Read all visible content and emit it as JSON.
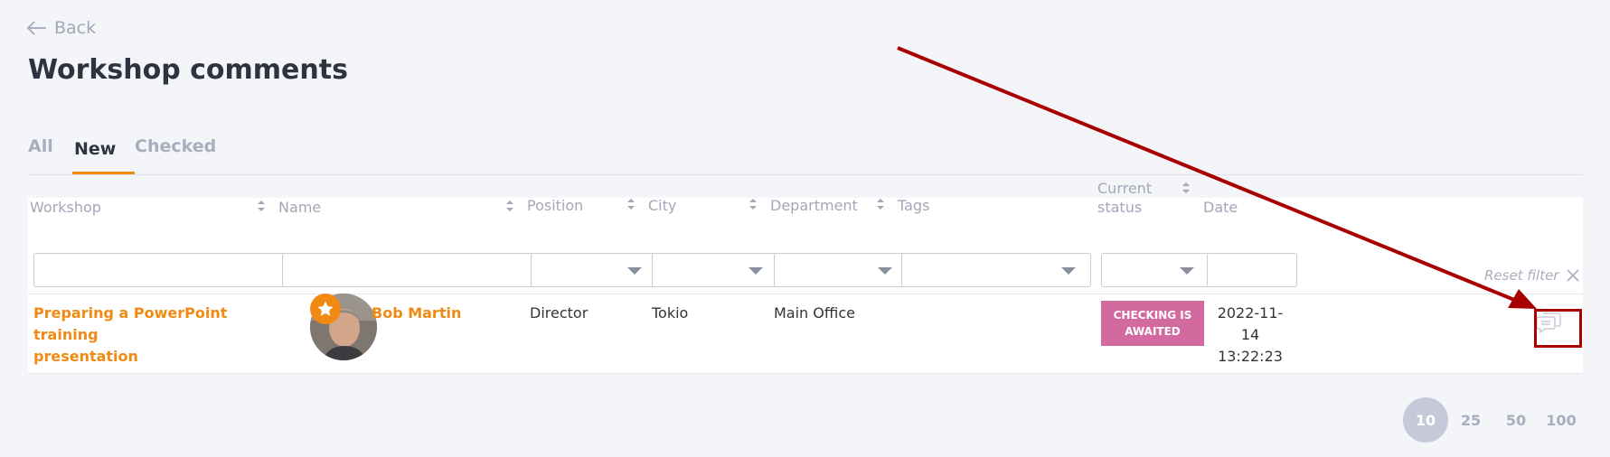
{
  "nav": {
    "back_label": "Back"
  },
  "page": {
    "title": "Workshop comments"
  },
  "tabs": [
    {
      "label": "All"
    },
    {
      "label": "New"
    },
    {
      "label": "Checked"
    }
  ],
  "table": {
    "columns": {
      "workshop": "Workshop",
      "name": "Name",
      "position": "Position",
      "city": "City",
      "department": "Department",
      "tags": "Tags",
      "status_line1": "Current",
      "status_line2": "status",
      "date": "Date"
    },
    "reset_filter": "Reset filter",
    "rows": [
      {
        "workshop_line1": "Preparing a PowerPoint training",
        "workshop_line2": "presentation",
        "name": "Bob Martin",
        "position": "Director",
        "city": "Tokio",
        "department": "Main Office",
        "tags": "",
        "status_line1": "CHECKING IS",
        "status_line2": "AWAITED",
        "date": "2022-11-14",
        "time": "13:22:23"
      }
    ]
  },
  "pagination": {
    "sizes": [
      "10",
      "25",
      "50",
      "100"
    ],
    "selected": "10"
  },
  "colors": {
    "accent": "#f08a12",
    "status_awaited": "#d26a9f",
    "annotation": "#a80000"
  }
}
